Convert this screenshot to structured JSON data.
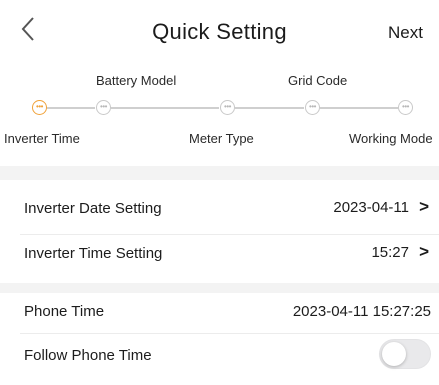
{
  "header": {
    "title": "Quick Setting",
    "next_label": "Next"
  },
  "steps": {
    "top_labels": [
      "Battery Model",
      "Grid Code"
    ],
    "bottom_labels": [
      "Inverter Time",
      "Meter Type",
      "Working Mode"
    ],
    "active_index": 0,
    "count": 5,
    "active_color": "#f0a23a"
  },
  "settings": {
    "date_label": "Inverter Date Setting",
    "date_value": "2023-04-11",
    "time_label": "Inverter Time Setting",
    "time_value": "15:27",
    "phone_time_label": "Phone Time",
    "phone_time_value": "2023-04-11 15:27:25",
    "follow_label": "Follow Phone Time",
    "follow_enabled": false,
    "chevron_glyph": ">"
  }
}
